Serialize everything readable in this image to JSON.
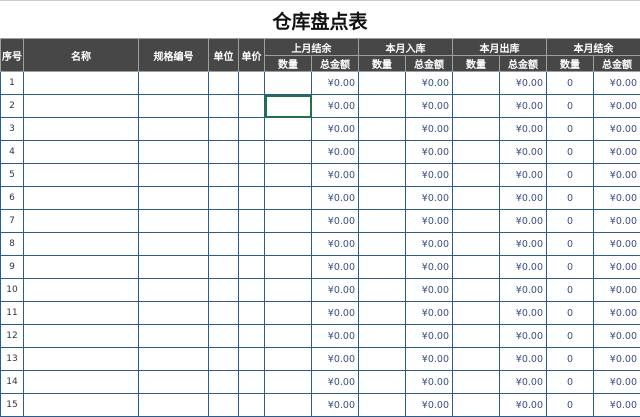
{
  "title": "仓库盘点表",
  "header": {
    "index": "序号",
    "name": "名称",
    "spec": "规格编号",
    "unit": "单位",
    "price": "单价",
    "groups": [
      "上月结余",
      "本月入库",
      "本月出库",
      "本月结余"
    ],
    "qty": "数量",
    "amount": "总金额"
  },
  "rows": [
    {
      "n": "1",
      "prev": "¥0.00",
      "in": "¥0.00",
      "out": "¥0.00",
      "bal_qty": "0",
      "bal_amt": "¥0.00"
    },
    {
      "n": "2",
      "prev": "¥0.00",
      "in": "¥0.00",
      "out": "¥0.00",
      "bal_qty": "0",
      "bal_amt": "¥0.00"
    },
    {
      "n": "3",
      "prev": "¥0.00",
      "in": "¥0.00",
      "out": "¥0.00",
      "bal_qty": "0",
      "bal_amt": "¥0.00"
    },
    {
      "n": "4",
      "prev": "¥0.00",
      "in": "¥0.00",
      "out": "¥0.00",
      "bal_qty": "0",
      "bal_amt": "¥0.00"
    },
    {
      "n": "5",
      "prev": "¥0.00",
      "in": "¥0.00",
      "out": "¥0.00",
      "bal_qty": "0",
      "bal_amt": "¥0.00"
    },
    {
      "n": "6",
      "prev": "¥0.00",
      "in": "¥0.00",
      "out": "¥0.00",
      "bal_qty": "0",
      "bal_amt": "¥0.00"
    },
    {
      "n": "7",
      "prev": "¥0.00",
      "in": "¥0.00",
      "out": "¥0.00",
      "bal_qty": "0",
      "bal_amt": "¥0.00"
    },
    {
      "n": "8",
      "prev": "¥0.00",
      "in": "¥0.00",
      "out": "¥0.00",
      "bal_qty": "0",
      "bal_amt": "¥0.00"
    },
    {
      "n": "9",
      "prev": "¥0.00",
      "in": "¥0.00",
      "out": "¥0.00",
      "bal_qty": "0",
      "bal_amt": "¥0.00"
    },
    {
      "n": "10",
      "prev": "¥0.00",
      "in": "¥0.00",
      "out": "¥0.00",
      "bal_qty": "0",
      "bal_amt": "¥0.00"
    },
    {
      "n": "11",
      "prev": "¥0.00",
      "in": "¥0.00",
      "out": "¥0.00",
      "bal_qty": "0",
      "bal_amt": "¥0.00"
    },
    {
      "n": "12",
      "prev": "¥0.00",
      "in": "¥0.00",
      "out": "¥0.00",
      "bal_qty": "0",
      "bal_amt": "¥0.00"
    },
    {
      "n": "13",
      "prev": "¥0.00",
      "in": "¥0.00",
      "out": "¥0.00",
      "bal_qty": "0",
      "bal_amt": "¥0.00"
    },
    {
      "n": "14",
      "prev": "¥0.00",
      "in": "¥0.00",
      "out": "¥0.00",
      "bal_qty": "0",
      "bal_amt": "¥0.00"
    },
    {
      "n": "15",
      "prev": "¥0.00",
      "in": "¥0.00",
      "out": "¥0.00",
      "bal_qty": "0",
      "bal_amt": "¥0.00"
    }
  ]
}
